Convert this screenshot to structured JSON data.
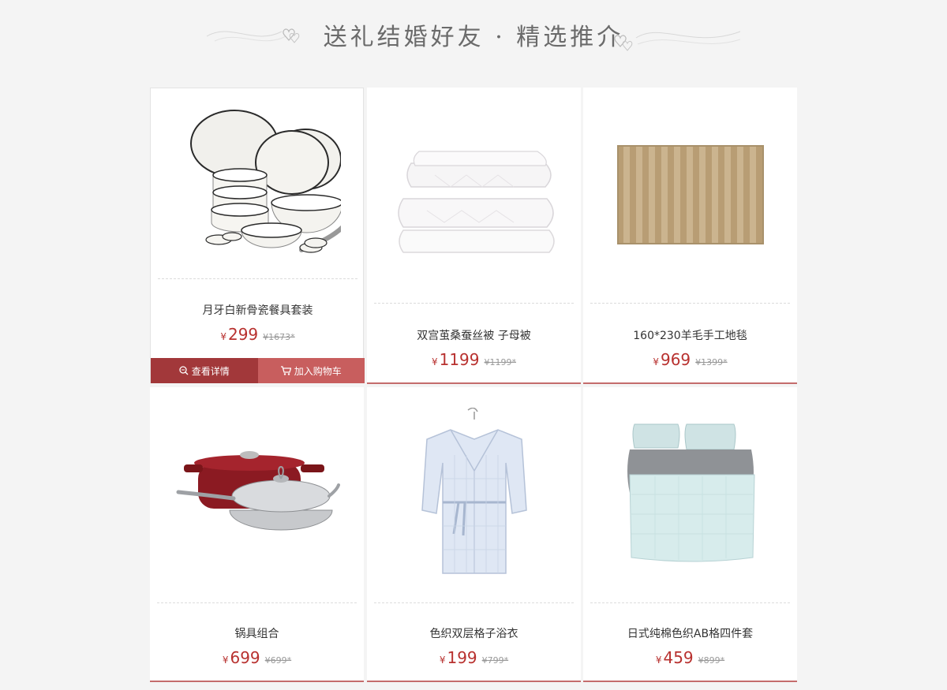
{
  "header": {
    "title": "送礼结婚好友 · 精选推介"
  },
  "currency_symbol": "¥",
  "colors": {
    "price": "#b8312f",
    "detail_button": "#a2383a",
    "cart_button": "#c85e5e",
    "card_border": "#c46c6c"
  },
  "active_actions": {
    "detail_label": "查看详情",
    "cart_label": "加入购物车"
  },
  "products": [
    {
      "name": "月牙白新骨瓷餐具套装",
      "price": "299",
      "original_price": "¥1673*",
      "icon": "dinnerware-image"
    },
    {
      "name": "双宫茧桑蚕丝被 子母被",
      "price": "1199",
      "original_price": "¥1199*",
      "icon": "silk-quilt-image"
    },
    {
      "name": "160*230羊毛手工地毯",
      "price": "969",
      "original_price": "¥1399*",
      "icon": "wool-rug-image"
    },
    {
      "name": "锅具组合",
      "price": "699",
      "original_price": "¥699*",
      "icon": "cookware-image"
    },
    {
      "name": "色织双层格子浴衣",
      "price": "199",
      "original_price": "¥799*",
      "icon": "bathrobe-image"
    },
    {
      "name": "日式纯棉色织AB格四件套",
      "price": "459",
      "original_price": "¥899*",
      "icon": "bedding-set-image"
    }
  ]
}
